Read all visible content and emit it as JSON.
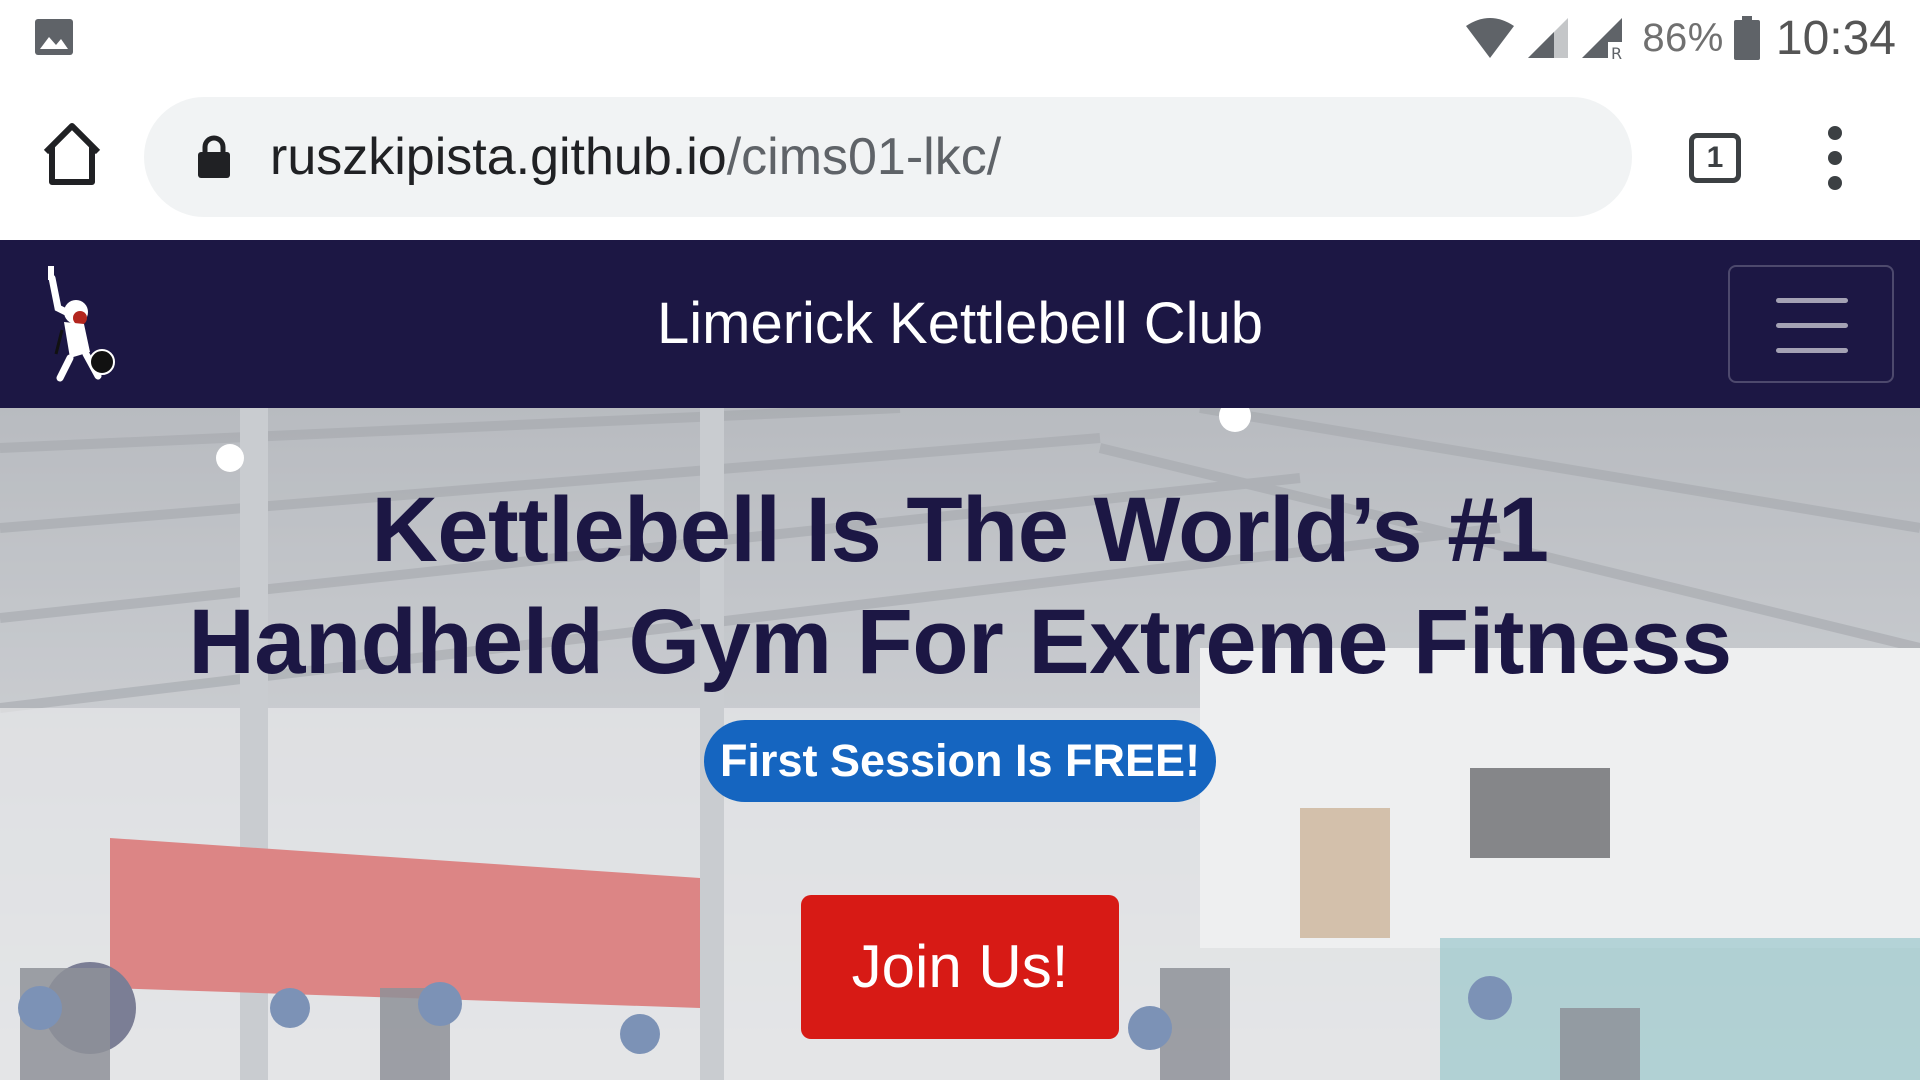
{
  "status_bar": {
    "battery_percent": "86%",
    "time": "10:34",
    "icons": [
      "gallery-icon",
      "wifi-icon",
      "cell-signal-icon",
      "cell-signal-roaming-icon",
      "battery-icon"
    ]
  },
  "browser": {
    "url_domain": "ruszkipista.github.io",
    "url_path": "/cims01-lkc/",
    "tab_count": "1",
    "icons": [
      "home-icon",
      "lock-icon",
      "tabs-icon",
      "more-vert-icon"
    ]
  },
  "site": {
    "brand": "Limerick Kettlebell Club",
    "nav_color": "#1c1744",
    "icons": [
      "logo-icon",
      "hamburger-icon"
    ]
  },
  "hero": {
    "title_line1": "Kettlebell Is The World’s #1",
    "title_line2": "Handheld Gym For Extreme Fitness",
    "badge": "First Session Is FREE!",
    "cta": "Join Us!",
    "colors": {
      "title": "#1c1744",
      "badge": "#1565c0",
      "cta": "#d71a15"
    }
  }
}
